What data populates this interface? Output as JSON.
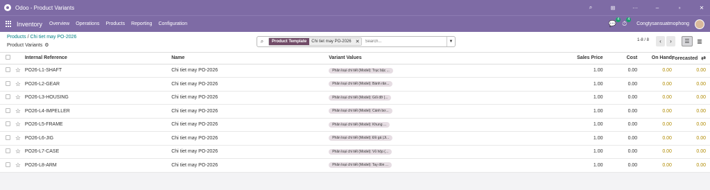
{
  "window": {
    "title": "Odoo - Product Variants"
  },
  "titlebar_icons": [
    "search-icon",
    "extensions-icon",
    "more-icon",
    "minimize-icon",
    "restore-icon",
    "close-icon"
  ],
  "nav": {
    "brand": "Inventory",
    "menu": [
      "Overview",
      "Operations",
      "Products",
      "Reporting",
      "Configuration"
    ],
    "chat_badge": "4",
    "activity_badge": "4",
    "user": "Congtysansuatmophong"
  },
  "breadcrumb": {
    "root": "Products",
    "separator": "/",
    "current": "Chi tiet may PO-2026"
  },
  "page_subtitle": "Product Variants",
  "search": {
    "facet_name": "Product Template",
    "facet_value": "Chi tiet may PO-2026",
    "placeholder": "Search..."
  },
  "pager": {
    "text": "1-8 / 8"
  },
  "table": {
    "columns": {
      "ref": "Internal Reference",
      "name": "Name",
      "variants": "Variant Values",
      "price": "Sales Price",
      "cost": "Cost",
      "on_hand": "On Hand",
      "forecasted": "Forecasted"
    },
    "rows": [
      {
        "ref": "PO26-L1-SHAFT",
        "name": "Chi tiet may PO-2026",
        "variant": "Phân loại chi tiết (Model): Trục bậc ...",
        "price": "1.00",
        "cost": "0.00",
        "on_hand": "0.00",
        "forecasted": "0.00"
      },
      {
        "ref": "PO26-L2-GEAR",
        "name": "Chi tiet may PO-2026",
        "variant": "Phân loại chi tiết (Model): Bánh răn...",
        "price": "1.00",
        "cost": "0.00",
        "on_hand": "0.00",
        "forecasted": "0.00"
      },
      {
        "ref": "PO26-L3-HOUSING",
        "name": "Chi tiet may PO-2026",
        "variant": "Phân loại chi tiết (Model): Gối đỡ (...",
        "price": "1.00",
        "cost": "0.00",
        "on_hand": "0.00",
        "forecasted": "0.00"
      },
      {
        "ref": "PO26-L4-IMPELLER",
        "name": "Chi tiet may PO-2026",
        "variant": "Phân loại chi tiết (Model): Cánh bơ...",
        "price": "1.00",
        "cost": "0.00",
        "on_hand": "0.00",
        "forecasted": "0.00"
      },
      {
        "ref": "PO26-L5-FRAME",
        "name": "Chi tiet may PO-2026",
        "variant": "Phân loại chi tiết (Model): Khung ...",
        "price": "1.00",
        "cost": "0.00",
        "on_hand": "0.00",
        "forecasted": "0.00"
      },
      {
        "ref": "PO26-L6-JIG",
        "name": "Chi tiet may PO-2026",
        "variant": "Phân loại chi tiết (Model): Đồ gá (Ji...",
        "price": "1.00",
        "cost": "0.00",
        "on_hand": "0.00",
        "forecasted": "0.00"
      },
      {
        "ref": "PO26-L7-CASE",
        "name": "Chi tiet may PO-2026",
        "variant": "Phân loại chi tiết (Model): Vỏ hộp (...",
        "price": "1.00",
        "cost": "0.00",
        "on_hand": "0.00",
        "forecasted": "0.00"
      },
      {
        "ref": "PO26-L8-ARM",
        "name": "Chi tiet may PO-2026",
        "variant": "Phân loại chi tiết (Model): Tay đòn ...",
        "price": "1.00",
        "cost": "0.00",
        "on_hand": "0.00",
        "forecasted": "0.00"
      }
    ]
  },
  "colors": {
    "navbar": "#7e6ba5",
    "facet": "#714b67",
    "link": "#017e84",
    "forecast": "#b08a00",
    "badge": "#1a9e6e"
  }
}
